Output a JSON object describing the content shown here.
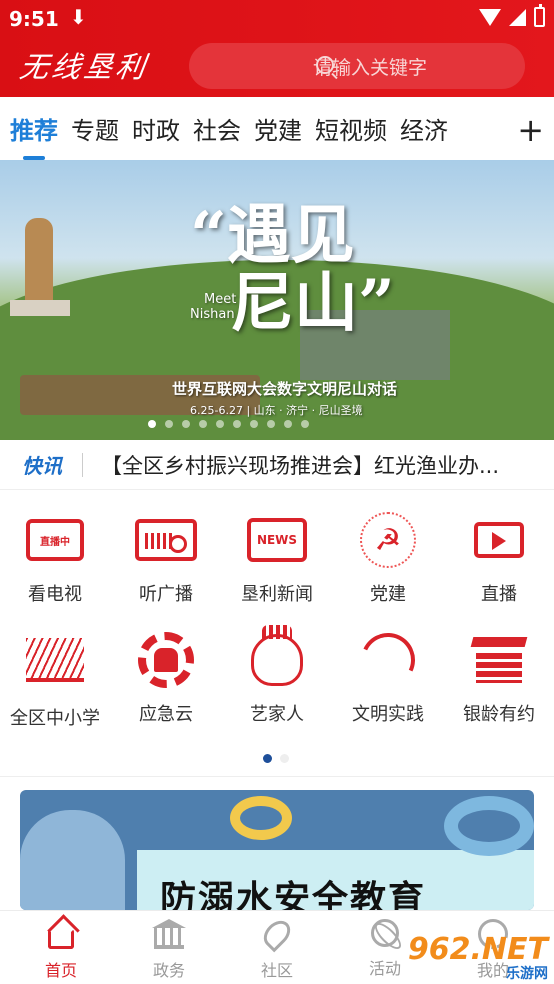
{
  "status": {
    "time": "9:51",
    "download": "⬇"
  },
  "header": {
    "logo": "无线垦利",
    "search_placeholder": "请输入关键字"
  },
  "tabs": [
    "推荐",
    "专题",
    "时政",
    "社会",
    "党建",
    "短视频",
    "经济"
  ],
  "tab_add": "+",
  "banner": {
    "title_line1": "“遇见",
    "title_line2": "尼山”",
    "meet_line1": "Meet",
    "meet_line2": "Nishan",
    "subtitle": "世界互联网大会数字文明尼山对话",
    "date": "6.25-6.27 | 山东 · 济宁 · 尼山圣境",
    "dots": 10,
    "active_dot": 0
  },
  "ticker": {
    "badge": "快讯",
    "text": "【全区乡村振兴现场推进会】红光渔业办..."
  },
  "grid": [
    {
      "label": "看电视",
      "icon": "tv-icon",
      "inner": "直播中"
    },
    {
      "label": "听广播",
      "icon": "radio-icon"
    },
    {
      "label": "垦利新闻",
      "icon": "news-icon",
      "inner": "NEWS"
    },
    {
      "label": "党建",
      "icon": "party-emblem-icon",
      "inner": "☭"
    },
    {
      "label": "直播",
      "icon": "live-video-icon"
    },
    {
      "label": "全区中小学",
      "icon": "book-icon"
    },
    {
      "label": "应急云",
      "icon": "emergency-gear-icon"
    },
    {
      "label": "艺家人",
      "icon": "opera-mask-icon"
    },
    {
      "label": "文明实践",
      "icon": "civilization-swirl-icon"
    },
    {
      "label": "银龄有约",
      "icon": "stacked-books-icon"
    }
  ],
  "grid_pages": 2,
  "promo": {
    "title": "防溺水安全教育"
  },
  "nav": [
    {
      "label": "首页",
      "icon": "home-icon",
      "active": true
    },
    {
      "label": "政务",
      "icon": "government-icon",
      "active": false
    },
    {
      "label": "社区",
      "icon": "location-pin-icon",
      "active": false
    },
    {
      "label": "活动",
      "icon": "activity-icon",
      "active": false
    },
    {
      "label": "我的",
      "icon": "user-icon",
      "active": false
    }
  ],
  "watermark": {
    "brand": "962.NET",
    "sub": "乐游网"
  },
  "colors": {
    "brand_red": "#d90f14",
    "accent_blue": "#1e7fd8"
  }
}
